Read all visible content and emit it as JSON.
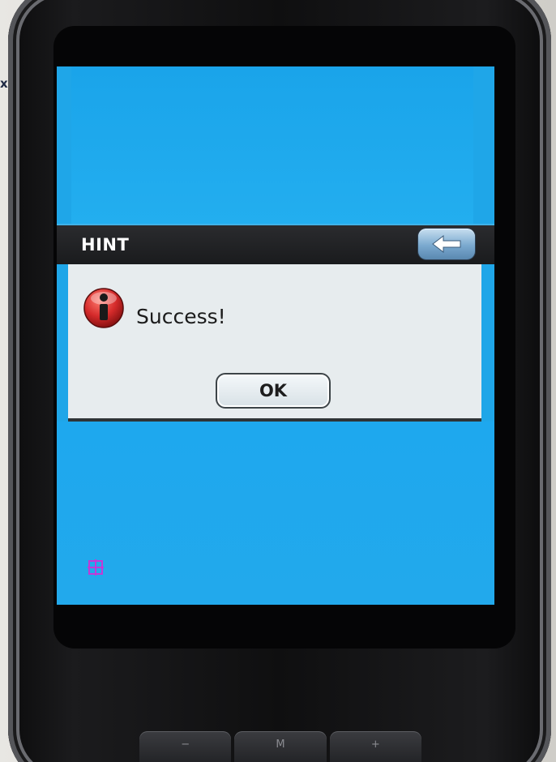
{
  "page": {
    "corner_text": "x."
  },
  "dialog": {
    "title": "HINT",
    "message": "Success!",
    "ok_label": "OK",
    "back_icon": "back-arrow-icon",
    "info_icon": "info-icon"
  },
  "hardware_buttons": [
    "−",
    "M",
    "+"
  ],
  "colors": {
    "screen_background": "#1fa6e8",
    "title_bar": "#1f2023",
    "dialog_body": "#e7ecee",
    "info_icon_red": "#d42a2a"
  }
}
